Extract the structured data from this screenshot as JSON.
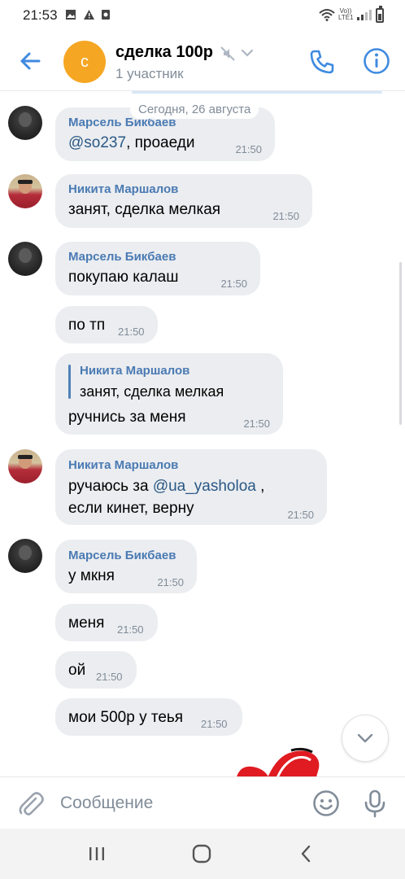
{
  "status_bar": {
    "time": "21:53",
    "network_label": "Vo)) LTE1"
  },
  "header": {
    "avatar_letter": "с",
    "title": "сделка 100р",
    "subtitle": "1 участник",
    "accent_color": "#3f8ae0"
  },
  "date_label": "Сегодня, 26 августа",
  "messages": [
    {
      "sender": "Марсель Бикбаев",
      "mention": "@so237",
      "text": ", проаеди",
      "time": "21:50"
    },
    {
      "sender": "Никита Маршалов",
      "text": "занят, сделка мелкая",
      "time": "21:50"
    },
    {
      "sender": "Марсель Бикбаев",
      "text": "покупаю калаш",
      "time": "21:50"
    },
    {
      "text": "по тп",
      "time": "21:50"
    },
    {
      "reply_name": "Никита Маршалов",
      "reply_text": "занят, сделка мелкая",
      "text": "ручнись за меня",
      "time": "21:50"
    },
    {
      "sender": "Никита Маршалов",
      "text_before": "ручаюсь за ",
      "mention": "@ua_yasholoa",
      "text_after": " ,",
      "text_line2": "если кинет, верну",
      "time": "21:50"
    },
    {
      "sender": "Марсель Бикбаев",
      "text": "у мкня",
      "time": "21:50"
    },
    {
      "text": "меня",
      "time": "21:50"
    },
    {
      "text": "ой",
      "time": "21:50"
    },
    {
      "text": "мои 500р у теья",
      "time": "21:50"
    }
  ],
  "composer": {
    "placeholder": "Сообщение"
  }
}
